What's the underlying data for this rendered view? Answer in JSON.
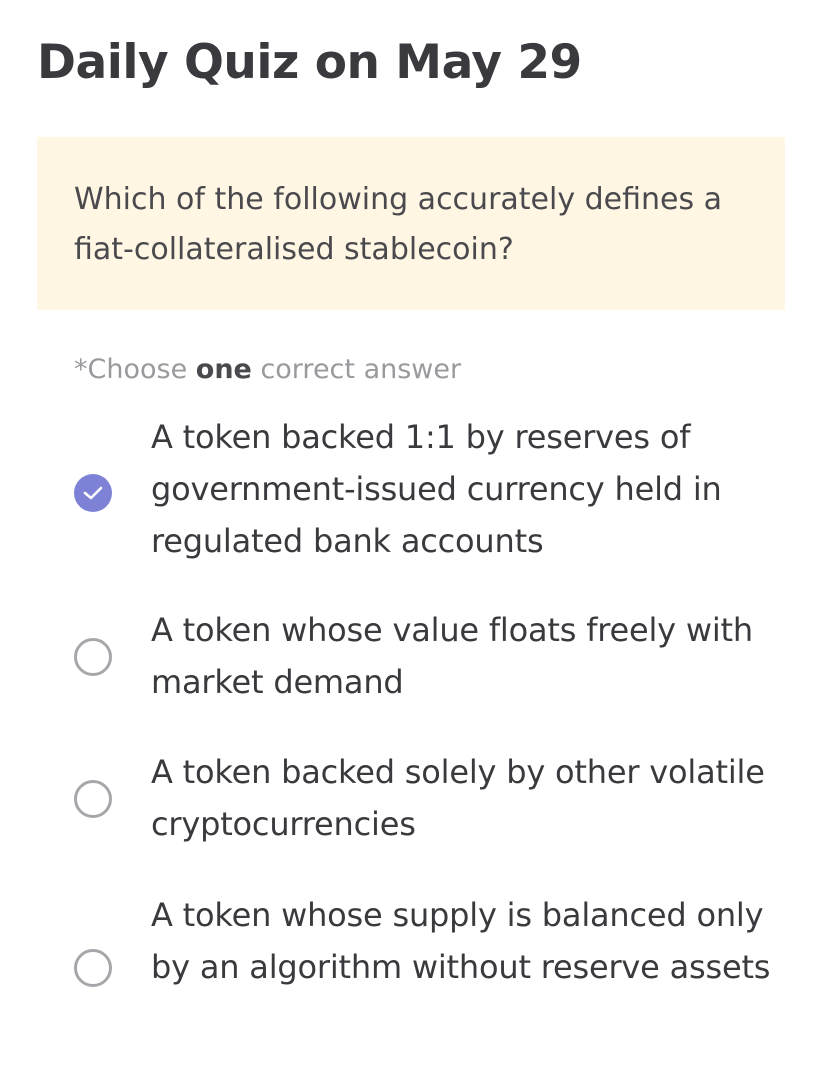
{
  "quiz": {
    "title": "Daily Quiz on May 29",
    "question": "Which of the following accurately defines a fiat-collateralised stablecoin?",
    "instruction": {
      "prefix": "*Choose ",
      "emphasis": "one",
      "suffix": " correct answer"
    },
    "options": [
      {
        "label": "A token backed 1:1 by reserves of government-issued currency held in regulated bank accounts",
        "selected": true
      },
      {
        "label": "A token whose value floats freely with market demand",
        "selected": false
      },
      {
        "label": "A token backed solely by other volatile cryptocurrencies",
        "selected": false
      },
      {
        "label": "A token whose supply is balanced only by an algorithm without reserve assets",
        "selected": false
      }
    ]
  },
  "colors": {
    "question_background": "#fff6e4",
    "selected_radio": "#7d82d6",
    "unselected_radio_border": "#a7a7ab",
    "instruction_text": "#9a9a9e"
  },
  "icons": {
    "selected": "check-icon",
    "unselected": "empty-radio-circle"
  }
}
